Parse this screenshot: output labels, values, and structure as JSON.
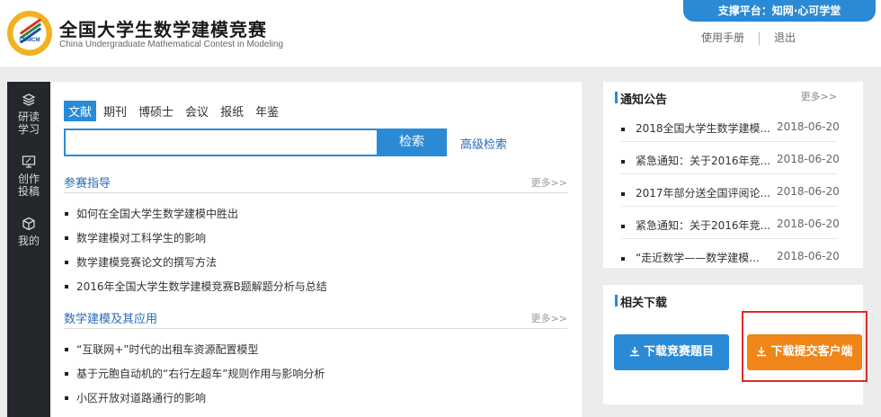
{
  "header": {
    "logo_text": "CUMCM",
    "title": "全国大学生数学建模竞赛",
    "subtitle": "China Undergraduate Mathematical Contest in Modeling",
    "platform": "支撑平台：知网·心可学堂",
    "links": [
      "使用手册",
      "退出"
    ]
  },
  "sidebar": {
    "items": [
      {
        "label": "研读\n学习",
        "icon": "layers-icon"
      },
      {
        "label": "创作\n投稿",
        "icon": "monitor-icon"
      },
      {
        "label": "我的",
        "icon": "cube-icon"
      }
    ]
  },
  "search": {
    "tabs": [
      "文献",
      "期刊",
      "博硕士",
      "会议",
      "报纸",
      "年鉴"
    ],
    "active_tab": "文献",
    "placeholder": "",
    "button": "检索",
    "advanced": "高级检索"
  },
  "sections": [
    {
      "title": "参赛指导",
      "more": "更多>>",
      "items": [
        "如何在全国大学生数学建模中胜出",
        "数学建模对工科学生的影响",
        "数学建模竞赛论文的撰写方法",
        "2016年全国大学生数学建模竞赛B题解题分析与总结"
      ]
    },
    {
      "title": "数学建模及其应用",
      "more": "更多>>",
      "items": [
        "“互联网+”时代的出租车资源配置模型",
        "基于元胞自动机的“右行左超车”规则作用与影响分析",
        "小区开放对道路通行的影响"
      ]
    }
  ],
  "notice": {
    "title": "通知公告",
    "more": "更多>>",
    "items": [
      {
        "title": "2018全国大学生数学建模...",
        "date": "2018-06-20"
      },
      {
        "title": "紧急通知：关于2016年竞...",
        "date": "2018-06-20"
      },
      {
        "title": "2017年部分送全国评阅论...",
        "date": "2018-06-20"
      },
      {
        "title": "紧急通知：关于2016年竞...",
        "date": "2018-06-20"
      },
      {
        "title": "“走近数学——数学建模...",
        "date": "2018-06-20"
      }
    ]
  },
  "downloads": {
    "title": "相关下载",
    "buttons": [
      "下载竞赛题目",
      "下载提交客户端"
    ]
  },
  "colors": {
    "primary": "#2a8ad6",
    "orange": "#f08519",
    "sidebar": "#24272b",
    "highlight_box": "#e02a2a"
  }
}
